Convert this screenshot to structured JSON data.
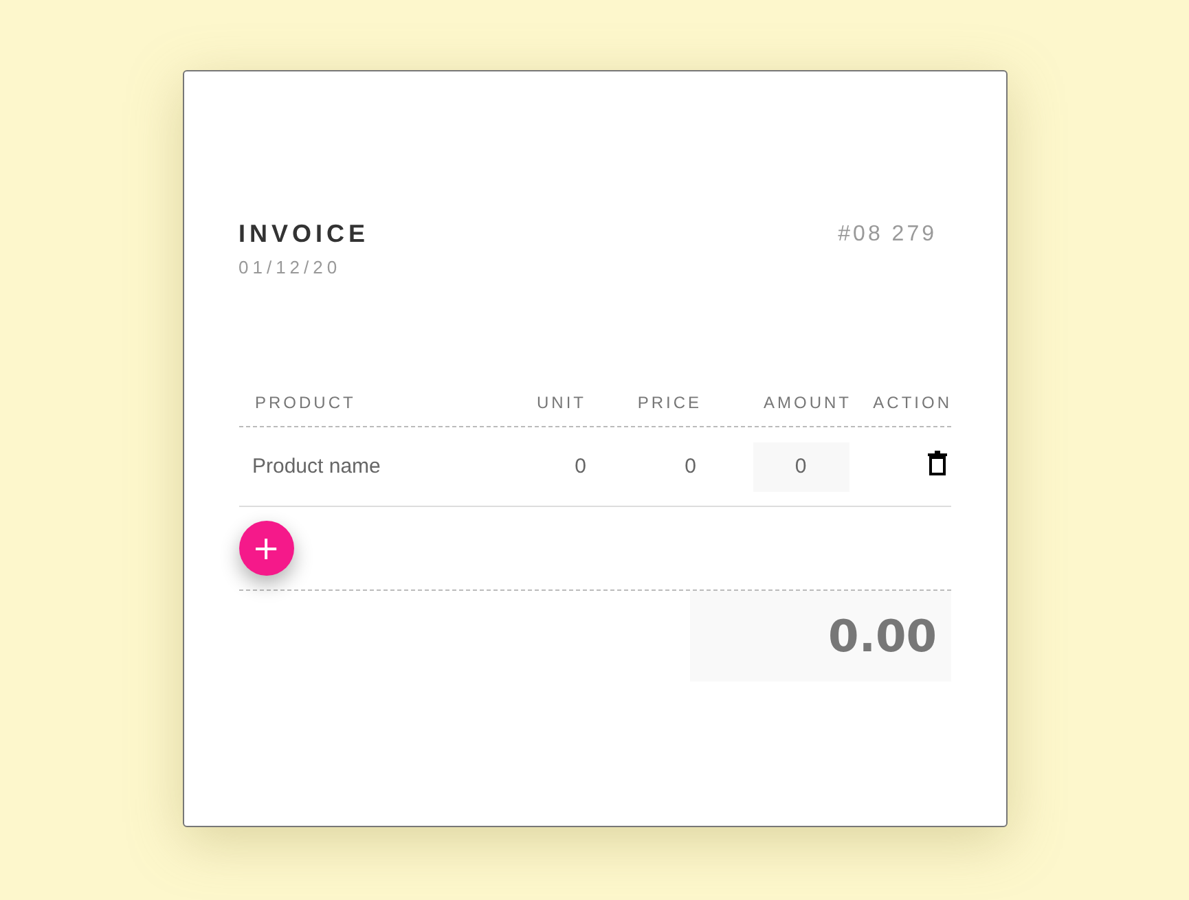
{
  "invoice": {
    "title": "INVOICE",
    "date": "01/12/20",
    "number": "#08 279"
  },
  "table": {
    "columns": [
      "PRODUCT",
      "UNIT",
      "PRICE",
      "AMOUNT",
      "ACTION"
    ],
    "rows": [
      {
        "product": "Product name",
        "unit": "0",
        "price": "0",
        "amount": "0"
      }
    ]
  },
  "add_button": {
    "label": "+"
  },
  "total": "0.00"
}
